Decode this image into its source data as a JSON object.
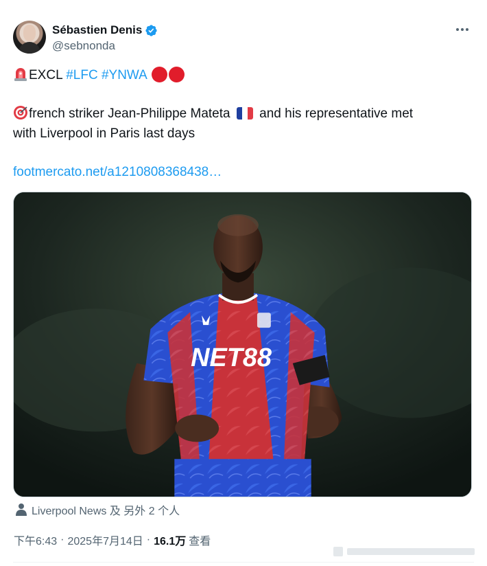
{
  "author": {
    "display_name": "Sébastien Denis",
    "handle": "@sebnonda",
    "verified": true
  },
  "tweet": {
    "excl_prefix": "EXCL",
    "hashtags": [
      "#LFC",
      "#YNWA"
    ],
    "line2a": "french striker Jean-Philippe Mateta",
    "line2b": "and his representative met",
    "line2c": "with Liverpool in Paris last days",
    "link": "footmercato.net/a1210808368438…",
    "media_shirt_text": "NET88"
  },
  "tagged": {
    "text": "Liverpool News 及 另外 2 个人"
  },
  "meta": {
    "time": "下午6:43",
    "date": "2025年7月14日",
    "views_count": "16.1万",
    "views_label": "查看",
    "separator": "·"
  },
  "colors": {
    "link": "#1d9bf0",
    "text": "#0f1419",
    "secondary": "#536471",
    "red_circle": "#e11d2b",
    "jersey_blue": "#2a4fd0",
    "jersey_red": "#c8323a"
  },
  "icons": [
    "verified-badge-icon",
    "more-icon",
    "siren-emoji-icon",
    "red-circle-icon",
    "target-emoji-icon",
    "french-flag-icon",
    "person-icon"
  ]
}
